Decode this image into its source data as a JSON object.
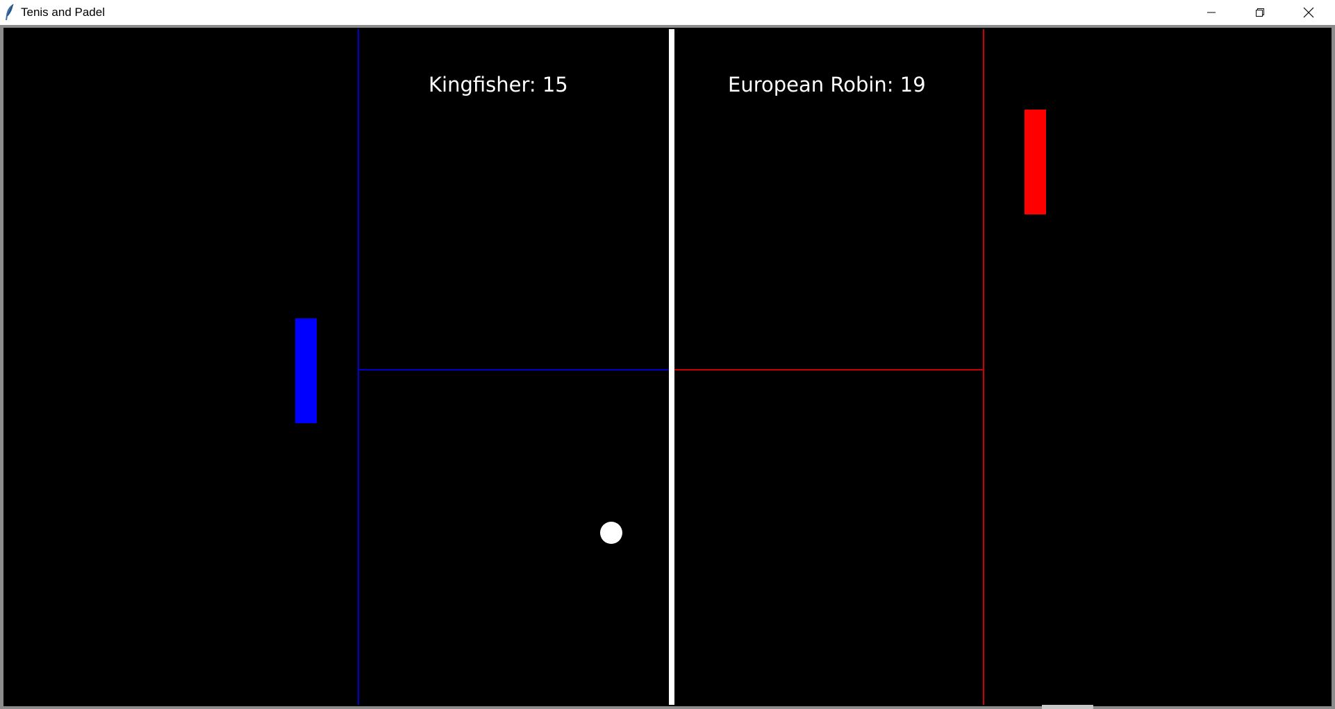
{
  "window": {
    "title": "Tenis and Padel",
    "icon": "feather-icon",
    "controls": {
      "minimize_icon": "minimize-icon",
      "restore_icon": "restore-icon",
      "close_icon": "close-icon"
    }
  },
  "game": {
    "background_color": "#000000",
    "left_player": {
      "name": "Kingfisher",
      "score": 15,
      "score_text": "Kingfisher: 15",
      "color": "#0000ff"
    },
    "right_player": {
      "name": "European Robin",
      "score": 19,
      "score_text": "European Robin: 19",
      "color": "#ff0000"
    },
    "net_color": "#ffffff",
    "ball_color": "#ffffff"
  }
}
